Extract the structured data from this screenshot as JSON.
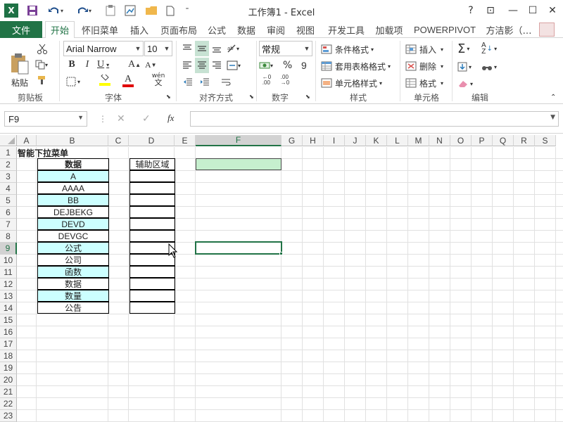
{
  "app": {
    "title": "工作簿1 - Excel",
    "logo_letter": "X"
  },
  "window_controls": {
    "help": "?",
    "restore_ribbon": "⊡",
    "minimize": "—",
    "maximize": "☐",
    "close": "✕"
  },
  "tabs": [
    {
      "label": "文件"
    },
    {
      "label": "开始"
    },
    {
      "label": "怀旧菜单"
    },
    {
      "label": "插入"
    },
    {
      "label": "页面布局"
    },
    {
      "label": "公式"
    },
    {
      "label": "数据"
    },
    {
      "label": "审阅"
    },
    {
      "label": "视图"
    },
    {
      "label": "开发工具"
    },
    {
      "label": "加载项"
    },
    {
      "label": "POWERPIVOT"
    },
    {
      "label": "方洁影（…"
    }
  ],
  "ribbon": {
    "clipboard": {
      "paste": "粘贴",
      "group": "剪贴板"
    },
    "font": {
      "font_name": "Arial Narrow",
      "font_size": "10",
      "bold": "B",
      "italic": "I",
      "underline": "U",
      "group": "字体",
      "wen": "wén"
    },
    "alignment": {
      "group": "对齐方式"
    },
    "number": {
      "format": "常规",
      "percent": "%",
      "comma": "9",
      "group": "数字"
    },
    "styles": {
      "conditional": "条件格式",
      "table": "套用表格格式",
      "cell": "单元格样式",
      "group": "样式"
    },
    "cells": {
      "insert": "插入",
      "delete": "删除",
      "format": "格式",
      "group": "单元格"
    },
    "editing": {
      "group": "编辑"
    }
  },
  "formula_bar": {
    "name_box": "F9",
    "fx": "fx",
    "value": ""
  },
  "columns": [
    "A",
    "B",
    "C",
    "D",
    "E",
    "F",
    "G",
    "H",
    "I",
    "J",
    "K",
    "L",
    "M",
    "N",
    "O",
    "P",
    "Q",
    "R",
    "S"
  ],
  "rows": [
    "1",
    "2",
    "3",
    "4",
    "5",
    "6",
    "7",
    "8",
    "9",
    "10",
    "11",
    "12",
    "13",
    "14",
    "15",
    "16",
    "17",
    "18",
    "19",
    "20",
    "21",
    "22",
    "23"
  ],
  "selected_cell": "F9",
  "sheet": {
    "title": "智能下拉菜单",
    "data_header": "数据",
    "aux_header": "辅助区域",
    "data": [
      "A",
      "AAAA",
      "BB",
      "DEJBEKG",
      "DEVD",
      "DEVGC",
      "公式",
      "公司",
      "函数",
      "数据",
      "数量",
      "公告"
    ]
  },
  "colors": {
    "excel_green": "#217346",
    "data_cell_fill": "#ccffff",
    "highlight_fill": "#c6efce",
    "header_fill": "#f3f3f3"
  }
}
